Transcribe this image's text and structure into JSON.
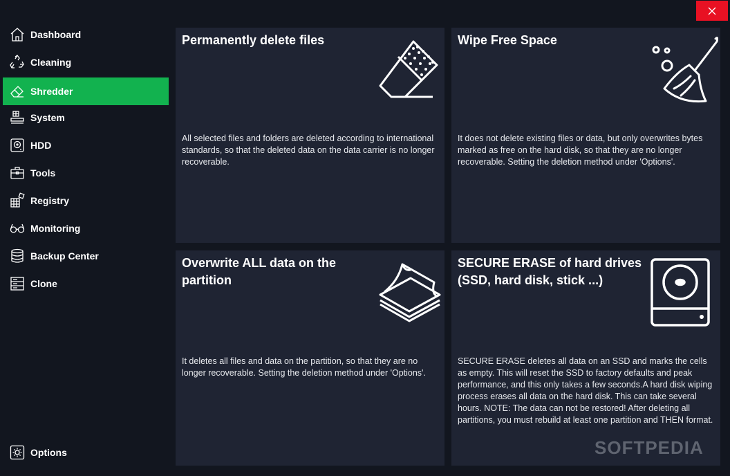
{
  "window": {
    "close_label": "✕"
  },
  "sidebar": {
    "items": [
      {
        "label": "Dashboard",
        "icon": "home-icon"
      },
      {
        "label": "Cleaning",
        "icon": "recycle-icon"
      },
      {
        "label": "Shredder",
        "icon": "eraser-icon",
        "active": true
      },
      {
        "label": "System",
        "icon": "system-icon"
      },
      {
        "label": "HDD",
        "icon": "hdd-icon"
      },
      {
        "label": "Tools",
        "icon": "toolbox-icon"
      },
      {
        "label": "Registry",
        "icon": "registry-icon"
      },
      {
        "label": "Monitoring",
        "icon": "glasses-icon"
      },
      {
        "label": "Backup Center",
        "icon": "database-icon"
      },
      {
        "label": "Clone",
        "icon": "clone-icon"
      }
    ],
    "options_label": "Options"
  },
  "cards": [
    {
      "title": "Permanently delete files",
      "description": "All selected files and folders are deleted according to international standards, so that the deleted data on the data carrier is no longer recoverable.",
      "icon": "eraser-icon"
    },
    {
      "title": "Wipe Free Space",
      "description": "It does not delete existing files or data, but only overwrites bytes marked as free on the hard disk, so that they are no longer recoverable. Setting the deletion method under 'Options'.",
      "icon": "broom-icon"
    },
    {
      "title": "Overwrite ALL data on the partition",
      "description": "It deletes all files and data on the partition, so that they are no longer recoverable. Setting the deletion method under 'Options'.",
      "icon": "paper-stack-icon"
    },
    {
      "title": "SECURE ERASE of hard drives (SSD, hard disk, stick ...)",
      "description": "SECURE ERASE deletes all data on an SSD and marks the cells as empty. This will reset the SSD to factory defaults and peak performance, and this only takes a few seconds.A hard disk wiping process erases all data on the hard disk. This can take several hours. NOTE: The data can not be restored! After deleting all partitions, you must rebuild at least one partition and THEN format.",
      "icon": "hard-drive-icon"
    }
  ],
  "watermark": "SOFTPEDIA",
  "colors": {
    "accent": "#12b24f",
    "card_bg": "#1f2433",
    "page_bg": "#12161f",
    "close": "#e81123"
  }
}
